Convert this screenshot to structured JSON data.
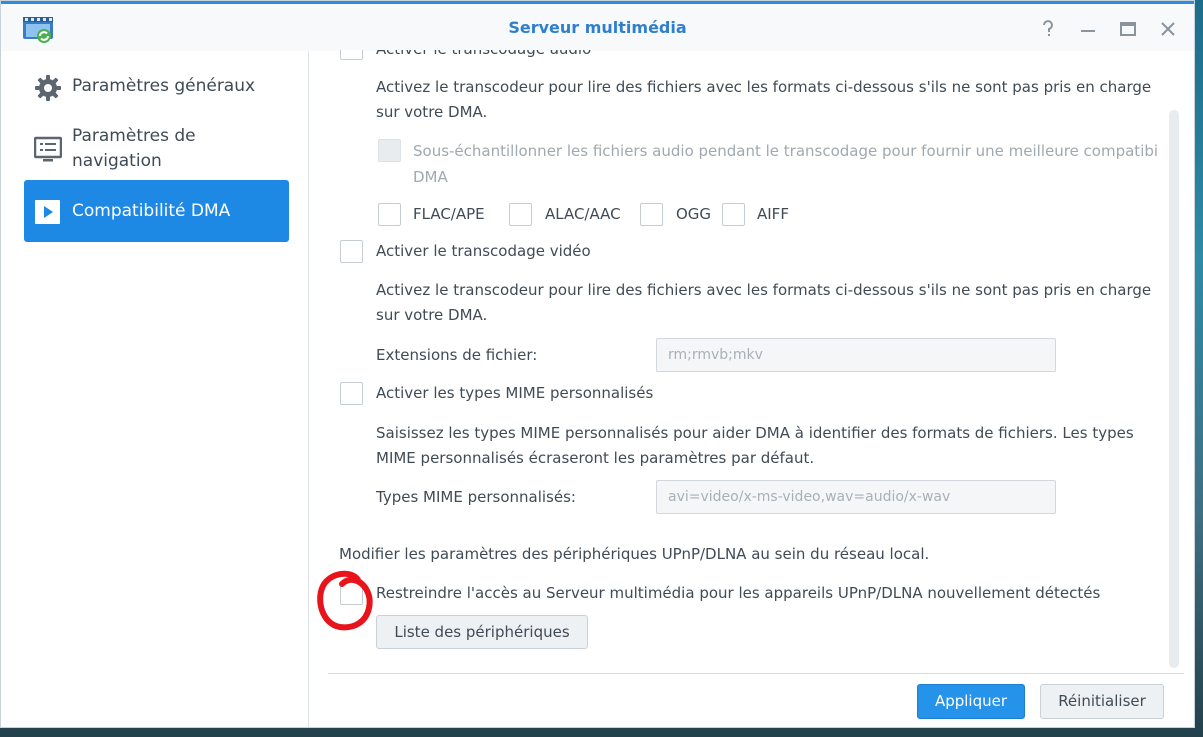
{
  "window": {
    "title": "Serveur multimédia",
    "accent_color": "#1e88e5"
  },
  "sidebar": {
    "items": [
      {
        "label": "Paramètres généraux",
        "icon": "gear-icon",
        "selected": false
      },
      {
        "label": "Paramètres de navigation",
        "icon": "monitor-list-icon",
        "selected": false
      },
      {
        "label": "Compatibilité DMA",
        "icon": "play-icon",
        "selected": true
      }
    ]
  },
  "content": {
    "audio_transcode": {
      "label": "Activer le transcodage audio",
      "description_line1": "Activez le transcodeur pour lire des fichiers avec les formats ci-dessous s'ils ne sont pas pris en charge",
      "description_line2": "sur votre DMA.",
      "downsample_line1": "Sous-échantillonner les fichiers audio pendant le transcodage pour fournir une meilleure compatibi",
      "downsample_line2": "DMA",
      "formats": [
        "FLAC/APE",
        "ALAC/AAC",
        "OGG",
        "AIFF"
      ]
    },
    "video_transcode": {
      "label": "Activer le transcodage vidéo",
      "description_line1": "Activez le transcodeur pour lire des fichiers avec les formats ci-dessous s'ils ne sont pas pris en charge",
      "description_line2": "sur votre DMA.",
      "extensions_label": "Extensions de fichier:",
      "extensions_placeholder": "rm;rmvb;mkv"
    },
    "mime": {
      "label": "Activer les types MIME personnalisés",
      "description_line1": "Saisissez les types MIME personnalisés pour aider DMA à identifier des formats de fichiers. Les types",
      "description_line2": "MIME personnalisés écraseront les paramètres par défaut.",
      "field_label": "Types MIME personnalisés:",
      "field_placeholder": "avi=video/x-ms-video,wav=audio/x-wav"
    },
    "upnp": {
      "note": "Modifier les paramètres des périphériques UPnP/DLNA au sein du réseau local.",
      "restrict_label": "Restreindre l'accès au Serveur multimédia pour les appareils UPnP/DLNA nouvellement détectés",
      "devices_button": "Liste des périphériques"
    }
  },
  "footer": {
    "apply": "Appliquer",
    "reset": "Réinitialiser"
  }
}
